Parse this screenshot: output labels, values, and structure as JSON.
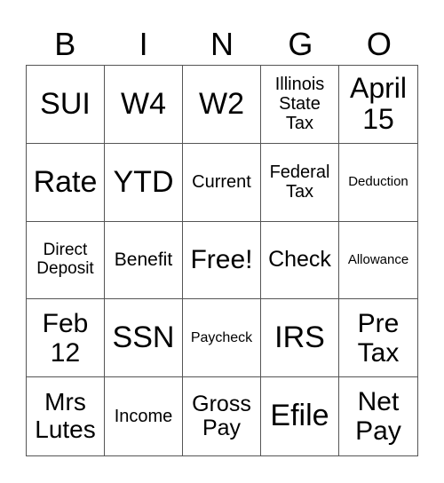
{
  "header": [
    "B",
    "I",
    "N",
    "G",
    "O"
  ],
  "cells": [
    {
      "text": "SUI",
      "size": 34
    },
    {
      "text": "W4",
      "size": 34
    },
    {
      "text": "W2",
      "size": 34
    },
    {
      "text": "Illinois\nState\nTax",
      "size": 20
    },
    {
      "text": "April\n15",
      "size": 32
    },
    {
      "text": "Rate",
      "size": 34
    },
    {
      "text": "YTD",
      "size": 34
    },
    {
      "text": "Current",
      "size": 20
    },
    {
      "text": "Federal\nTax",
      "size": 20
    },
    {
      "text": "Deduction",
      "size": 15
    },
    {
      "text": "Direct\nDeposit",
      "size": 19
    },
    {
      "text": "Benefit",
      "size": 21
    },
    {
      "text": "Free!",
      "size": 30
    },
    {
      "text": "Check",
      "size": 25
    },
    {
      "text": "Allowance",
      "size": 15
    },
    {
      "text": "Feb\n12",
      "size": 30
    },
    {
      "text": "SSN",
      "size": 34
    },
    {
      "text": "Paycheck",
      "size": 16
    },
    {
      "text": "IRS",
      "size": 34
    },
    {
      "text": "Pre\nTax",
      "size": 30
    },
    {
      "text": "Mrs\nLutes",
      "size": 28
    },
    {
      "text": "Income",
      "size": 20
    },
    {
      "text": "Gross\nPay",
      "size": 25
    },
    {
      "text": "Efile",
      "size": 34
    },
    {
      "text": "Net\nPay",
      "size": 30
    }
  ]
}
